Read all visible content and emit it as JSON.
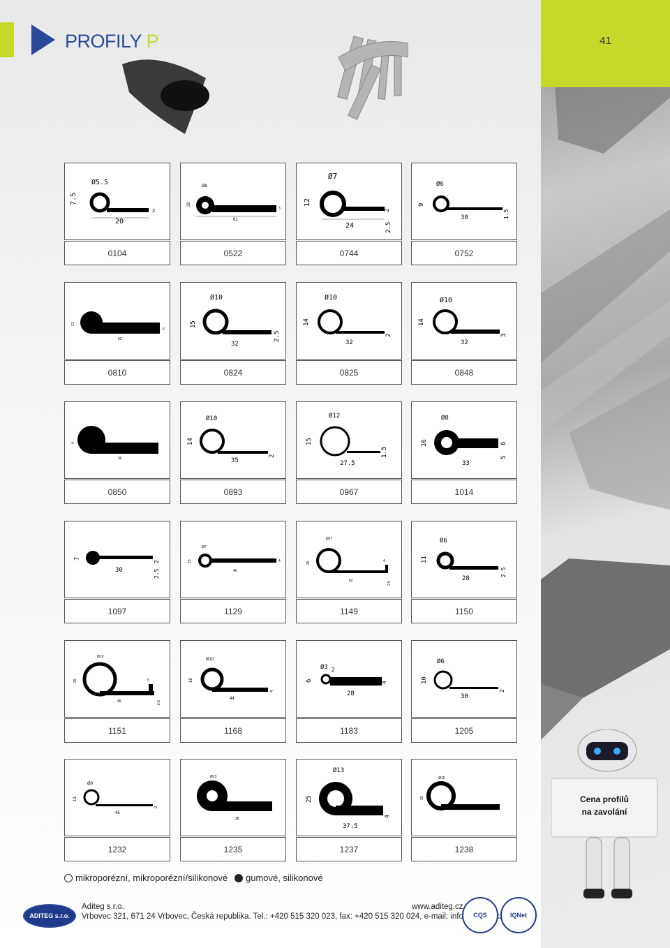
{
  "header": {
    "title_main": "PROFILY",
    "title_accent": "P",
    "page_number": "41"
  },
  "profiles": [
    {
      "code": "0104",
      "dims": [
        "Ø5.5",
        "7.5",
        "20",
        "2"
      ]
    },
    {
      "code": "0522",
      "dims": [
        "Ø8",
        "20",
        "61",
        "3"
      ]
    },
    {
      "code": "0744",
      "dims": [
        "Ø7",
        "12",
        "24",
        "2",
        "2.5"
      ]
    },
    {
      "code": "0752",
      "dims": [
        "Ø6",
        "9",
        "30",
        "1.5"
      ]
    },
    {
      "code": "0810",
      "dims": [
        "21",
        "62",
        "6"
      ]
    },
    {
      "code": "0824",
      "dims": [
        "Ø10",
        "15",
        "32",
        "2.5"
      ]
    },
    {
      "code": "0825",
      "dims": [
        "Ø10",
        "14",
        "32",
        "2"
      ]
    },
    {
      "code": "0848",
      "dims": [
        "Ø10",
        "14",
        "32",
        "3"
      ]
    },
    {
      "code": "0850",
      "dims": [
        "4",
        "30"
      ]
    },
    {
      "code": "0893",
      "dims": [
        "Ø10",
        "14",
        "35",
        "2"
      ]
    },
    {
      "code": "0967",
      "dims": [
        "Ø12",
        "15",
        "27.5",
        "1.5"
      ]
    },
    {
      "code": "1014",
      "dims": [
        "Ø8",
        "16",
        "33",
        "6",
        "5"
      ]
    },
    {
      "code": "1097",
      "dims": [
        "7",
        "30",
        "2",
        "2.5"
      ]
    },
    {
      "code": "1129",
      "dims": [
        "Ø7",
        "15",
        "45",
        "4"
      ]
    },
    {
      "code": "1149",
      "dims": [
        "Ø17",
        "25",
        "62",
        "4",
        "2.5"
      ]
    },
    {
      "code": "1150",
      "dims": [
        "Ø6",
        "11",
        "28",
        "2.5"
      ]
    },
    {
      "code": "1151",
      "dims": [
        "Ø19",
        "25",
        "45",
        "5",
        "2.5"
      ]
    },
    {
      "code": "1168",
      "dims": [
        "Ø10",
        "18",
        "44",
        "4"
      ]
    },
    {
      "code": "1183",
      "dims": [
        "Ø3",
        "6",
        "28",
        "4",
        "2"
      ]
    },
    {
      "code": "1205",
      "dims": [
        "Ø6",
        "10",
        "30",
        "2"
      ]
    },
    {
      "code": "1232",
      "dims": [
        "Ø9",
        "13",
        "45",
        "2"
      ]
    },
    {
      "code": "1235",
      "dims": [
        "Ø13",
        "38"
      ]
    },
    {
      "code": "1237",
      "dims": [
        "Ø13",
        "25",
        "37.5",
        "4"
      ]
    },
    {
      "code": "1238",
      "dims": [
        "Ø15",
        "32"
      ]
    }
  ],
  "legend": {
    "porous": "mikroporézní, mikroporézní/silikonové",
    "solid": "gumové, silikonové"
  },
  "robot_sign": {
    "line1": "Cena profilů",
    "line2": "na zavolání"
  },
  "footer": {
    "logo_text": "ADITEG s.r.o.",
    "company": "Aditeg s.r.o.",
    "address": "Vrbovec 321, 671 24  Vrbovec, Česká republika. Tel.: +420 515 320 023, fax: +420 515 320 024, e-mail: info@aditeg.cz",
    "website": "www.aditeg.cz",
    "cert1": "CQS",
    "cert2": "IQNet"
  },
  "colors": {
    "brand_blue": "#2a4a99",
    "accent_green": "#c6d92a"
  }
}
